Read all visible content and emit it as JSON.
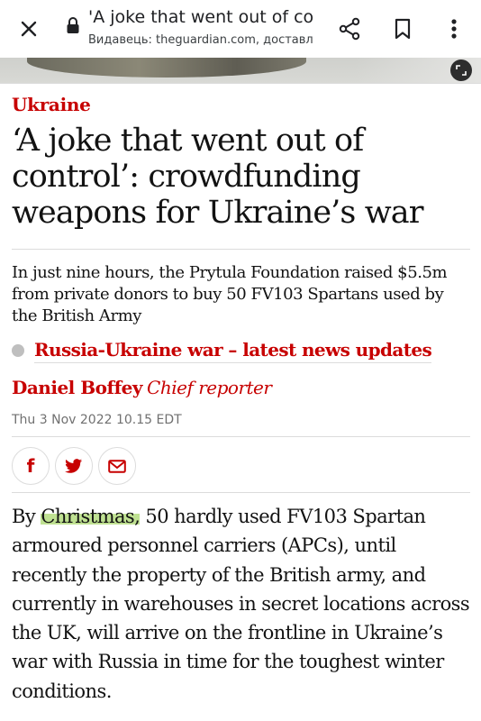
{
  "browser": {
    "title": "'A joke that went out of cont...",
    "subtitle": "Видавець: theguardian.com, доставлен",
    "icons": [
      "close-icon",
      "lock-icon",
      "share-icon",
      "bookmark-icon",
      "more-vert-icon"
    ]
  },
  "hero": {
    "icons": [
      "expand-icon"
    ]
  },
  "article": {
    "kicker": "Ukraine",
    "headline": "‘A joke that went out of control’: crowdfunding weapons for Ukraine’s war",
    "standfirst": "In just nine hours, the Prytula Foundation raised $5.5m from private donors to buy 50 FV103 Spartans used by the British Army",
    "live_link": "Russia-Ukraine war – latest news updates",
    "author": "Daniel Boffey",
    "author_role": "Chief reporter",
    "date": "Thu 3 Nov 2022 10.15 EDT",
    "share": {
      "facebook": "f",
      "icons": [
        "facebook-icon",
        "twitter-icon",
        "email-icon"
      ]
    },
    "body": {
      "pre": "By ",
      "highlight": "Christmas,",
      "post": " 50 hardly used FV103 Spartan armoured personnel carriers (APCs), until recently the property of the British army, and currently in warehouses in secret locations across the UK, will arrive on the frontline in Ukraine’s war with Russia in time for the toughest winter conditions."
    }
  },
  "colors": {
    "brand_red": "#c70000",
    "text": "#121212",
    "muted": "#707070",
    "divider": "#dcdcdc",
    "highlight": "#aad76e"
  }
}
